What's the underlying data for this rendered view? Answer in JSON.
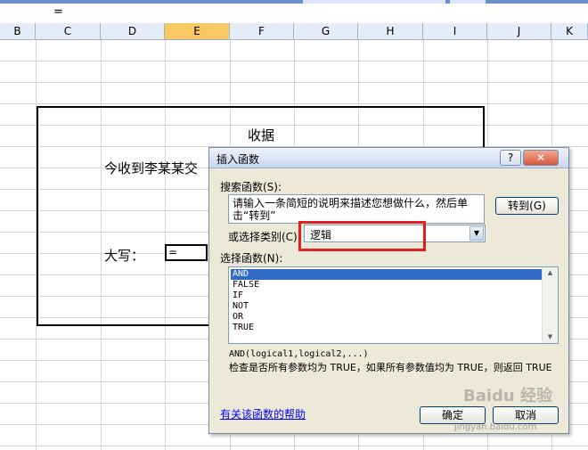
{
  "formula_bar": {
    "text": "="
  },
  "columns": [
    {
      "label": "B"
    },
    {
      "label": "C"
    },
    {
      "label": "D"
    },
    {
      "label": "E"
    },
    {
      "label": "F"
    },
    {
      "label": "G"
    },
    {
      "label": "H"
    },
    {
      "label": "I"
    },
    {
      "label": "J"
    },
    {
      "label": "K"
    }
  ],
  "selected_column": "E",
  "sheet": {
    "title": "收据",
    "line1": "今收到李某某交",
    "daxie_label": "大写：",
    "daxie_cell_value": "="
  },
  "dialog": {
    "title": "插入函数",
    "help_button": "?",
    "close_button": "✕",
    "search_label": "搜索函数(S):",
    "search_desc": "请输入一条简短的说明来描述您想做什么，然后单击“转到”",
    "goto_button": "转到(G)",
    "category_label": "或选择类别(C)",
    "category_value": "逻辑",
    "select_label": "选择函数(N):",
    "functions": [
      "AND",
      "FALSE",
      "IF",
      "NOT",
      "OR",
      "TRUE"
    ],
    "selected_function": "AND",
    "syntax": "AND(logical1,logical2,...)",
    "description": "检查是否所有参数均为 TRUE，如果所有参数值均为 TRUE，则返回 TRUE",
    "help_link": "有关该函数的帮助",
    "ok_button": "确定",
    "cancel_button": "取消"
  },
  "watermark": {
    "text": "Baidu 经验",
    "url_text": "jingyan.baidu.com"
  },
  "colors": {
    "selection": "#316ac5",
    "highlight_box": "#e02020",
    "selected_column": "#f8c963"
  }
}
